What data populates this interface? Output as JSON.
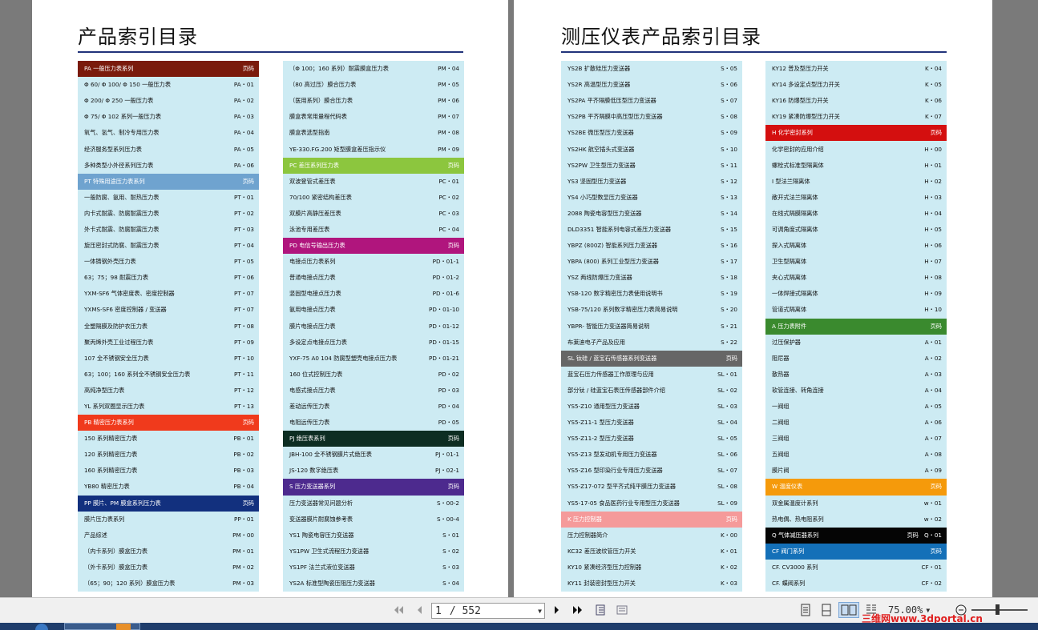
{
  "left_page": {
    "title": "产品索引目录",
    "col1": [
      {
        "label": "PA 一般压力表系列",
        "code": "页码",
        "header": true,
        "color": "#7a1a0c"
      },
      {
        "label": "Φ 60/ Φ 100/ Φ 150 一般压力表",
        "code": "PA・01"
      },
      {
        "label": "Φ 200/ Φ 250 一般压力表",
        "code": "PA・02"
      },
      {
        "label": "Φ 75/ Φ 102 系列一般压力表",
        "code": "PA・03"
      },
      {
        "label": "氧气、氢气、制冷专用压力表",
        "code": "PA・04"
      },
      {
        "label": "经济服务型系列压力表",
        "code": "PA・05"
      },
      {
        "label": "多种类型小外径系列压力表",
        "code": "PA・06"
      },
      {
        "label": "PT 特殊用途压力表系列",
        "code": "页码",
        "header": true,
        "color": "#6fa3cf"
      },
      {
        "label": "一般防腐、氨用、耐热压力表",
        "code": "PT・01"
      },
      {
        "label": "内卡式耐震、防腐耐震压力表",
        "code": "PT・02"
      },
      {
        "label": "外卡式耐震、防腐耐震压力表",
        "code": "PT・03"
      },
      {
        "label": "旋压密封式防腐、耐震压力表",
        "code": "PT・04"
      },
      {
        "label": "一体铸钢外壳压力表",
        "code": "PT・05"
      },
      {
        "label": "63；75；98 耐震压力表",
        "code": "PT・06"
      },
      {
        "label": "YXM-SF6 气体密度表、密度控制器",
        "code": "PT・07"
      },
      {
        "label": "YXMS-SF6 密度控制器 / 变送器",
        "code": "PT・07"
      },
      {
        "label": "全塑隔膜及防护衣压力表",
        "code": "PT・08"
      },
      {
        "label": "聚丙烯外壳工业过程压力表",
        "code": "PT・09"
      },
      {
        "label": "107 全不锈钢安全压力表",
        "code": "PT・10"
      },
      {
        "label": "63；100；160 系列全不锈钢安全压力表",
        "code": "PT・11"
      },
      {
        "label": "高纯净型压力表",
        "code": "PT・12"
      },
      {
        "label": "YL 系列双圈显示压力表",
        "code": "PT・13"
      },
      {
        "label": "PB 精密压力表系列",
        "code": "页码",
        "header": true,
        "color": "#f03a1c"
      },
      {
        "label": "150 系列精密压力表",
        "code": "PB・01"
      },
      {
        "label": "120 系列精密压力表",
        "code": "PB・02"
      },
      {
        "label": "160 系列精密压力表",
        "code": "PB・03"
      },
      {
        "label": "YB80 精密压力表",
        "code": "PB・04"
      },
      {
        "label": "PP 膜片、PM 膜盒系列压力表",
        "code": "页码",
        "header": true,
        "color": "#12307e"
      },
      {
        "label": "膜片压力表系列",
        "code": "PP・01"
      },
      {
        "label": "产品综述",
        "code": "PM・00"
      },
      {
        "label": "（内卡系列）膜盒压力表",
        "code": "PM・01"
      },
      {
        "label": "（外卡系列）膜盒压力表",
        "code": "PM・02"
      },
      {
        "label": "（65；90；120 系列）膜盒压力表",
        "code": "PM・03"
      }
    ],
    "col2": [
      {
        "label": "（Φ 100；160 系列）耐震膜盒压力表",
        "code": "PM・04"
      },
      {
        "label": "（80 高过压）膜合压力表",
        "code": "PM・05"
      },
      {
        "label": "（医用系列）膜合压力表",
        "code": "PM・06"
      },
      {
        "label": "膜盒表常用量程代码表",
        "code": "PM・07"
      },
      {
        "label": "膜盒表选型指南",
        "code": "PM・08"
      },
      {
        "label": "YE-330.FG.200 矩型膜盒差压指示仪",
        "code": "PM・09"
      },
      {
        "label": "PC 差压系列压力表",
        "code": "页码",
        "header": true,
        "color": "#8cc63e"
      },
      {
        "label": "双波登管式差压表",
        "code": "PC・01"
      },
      {
        "label": "70/100 紧密结构差压表",
        "code": "PC・02"
      },
      {
        "label": "双膜片高静压差压表",
        "code": "PC・03"
      },
      {
        "label": "泳池专用差压表",
        "code": "PC・04"
      },
      {
        "label": "PD 电信号输出压力表",
        "code": "页码",
        "header": true,
        "color": "#b0157d"
      },
      {
        "label": "电接点压力表系列",
        "code": "PD・01-1"
      },
      {
        "label": "普通电接点压力表",
        "code": "PD・01-2"
      },
      {
        "label": "竖固型电接点压力表",
        "code": "PD・01-6"
      },
      {
        "label": "氨用电接点压力表",
        "code": "PD・01-10"
      },
      {
        "label": "膜片电接点压力表",
        "code": "PD・01-12"
      },
      {
        "label": "多设定点电接点压力表",
        "code": "PD・01-15"
      },
      {
        "label": "YXF-75 A0 104 防腐型塑壳电接点压力表",
        "code": "PD・01-21"
      },
      {
        "label": "160 位式控制压力表",
        "code": "PD・02"
      },
      {
        "label": "电感式接点压力表",
        "code": "PD・03"
      },
      {
        "label": "差动远传压力表",
        "code": "PD・04"
      },
      {
        "label": "电阻远传压力表",
        "code": "PD・05"
      },
      {
        "label": "PJ 绝压表系列",
        "code": "页码",
        "header": true,
        "color": "#0d2d22"
      },
      {
        "label": "JBH-100 全不锈钢膜片式绝压表",
        "code": "PJ・01-1"
      },
      {
        "label": "JS-120 数字绝压表",
        "code": "PJ・02-1"
      },
      {
        "label": "S 压力变送器系列",
        "code": "页码",
        "header": true,
        "color": "#4d2a8e"
      },
      {
        "label": "压力变送器常见问题分析",
        "code": "S・00-2"
      },
      {
        "label": "变送器膜片耐腐蚀参考表",
        "code": "S・00-4"
      },
      {
        "label": "YS1 陶瓷电容压力变送器",
        "code": "S・01"
      },
      {
        "label": "YS1PW 卫生式流程压力变送器",
        "code": "S・02"
      },
      {
        "label": "YS1PF 法兰式液位变送器",
        "code": "S・03"
      },
      {
        "label": "YS2A 标准型陶瓷压阻压力变送器",
        "code": "S・04"
      }
    ]
  },
  "right_page": {
    "title": "测压仪表产品索引目录",
    "col1": [
      {
        "label": "YS2B 扩散硅压力变送器",
        "code": "S・05"
      },
      {
        "label": "YS2R 高温型压力变送器",
        "code": "S・06"
      },
      {
        "label": "YS2PA 平齐隔膜低压型压力变送器",
        "code": "S・07"
      },
      {
        "label": "YS2PB 平齐隔膜中高压型压力变送器",
        "code": "S・08"
      },
      {
        "label": "YS2BE 微压型压力变送器",
        "code": "S・09"
      },
      {
        "label": "YS2HK 航空插头式变送器",
        "code": "S・10"
      },
      {
        "label": "YS2PW 卫生型压力变送器",
        "code": "S・11"
      },
      {
        "label": "YS3 坚固型压力变送器",
        "code": "S・12"
      },
      {
        "label": "YS4 小巧型数显压力变送器",
        "code": "S・13"
      },
      {
        "label": "2088 陶瓷电容型压力变送器",
        "code": "S・14"
      },
      {
        "label": "DLD3351 智能系列电容式差压力变送器",
        "code": "S・15"
      },
      {
        "label": "YBPZ (800Z) 智能系列压力变送器",
        "code": "S・16"
      },
      {
        "label": "YBPA (800) 系列工业型压力变送器",
        "code": "S・17"
      },
      {
        "label": "YSZ 两线防爆压力变送器",
        "code": "S・18"
      },
      {
        "label": "YSB-120 数字精密压力表使用说明书",
        "code": "S・19"
      },
      {
        "label": "YSB-75/120 系列数字精密压力表简易说明",
        "code": "S・20"
      },
      {
        "label": "YBPR- 智能压力变送器简易说明",
        "code": "S・21"
      },
      {
        "label": "布莱迪电子产品及应用",
        "code": "S・22"
      },
      {
        "label": "SL 钛硅 / 蓝宝石传感器系列变送器",
        "code": "页码",
        "header": true,
        "color": "#666666"
      },
      {
        "label": "蓝宝石压力传感器工作原理与应用",
        "code": "SL・01"
      },
      {
        "label": "部分钛 / 硅蓝宝石表压传感器部件介绍",
        "code": "SL・02"
      },
      {
        "label": "YS5-Z10 通用型压力变送器",
        "code": "SL・03"
      },
      {
        "label": "YS5-Z11-1 型压力变送器",
        "code": "SL・04"
      },
      {
        "label": "YS5-Z11-2 型压力变送器",
        "code": "SL・05"
      },
      {
        "label": "YS5-Z13 型发动机专用压力变送器",
        "code": "SL・06"
      },
      {
        "label": "YS5-Z16 型印染行业专用压力变送器",
        "code": "SL・07"
      },
      {
        "label": "YS5-Z17-072 型平齐式纯平膜压力变送器",
        "code": "SL・08"
      },
      {
        "label": "YS5-17-05 食品医药行业专用型压力变送器",
        "code": "SL・09"
      },
      {
        "label": "K 压力控制器",
        "code": "页码",
        "header": true,
        "color": "#f59a9a"
      },
      {
        "label": "压力控制器简介",
        "code": "K・00"
      },
      {
        "label": "KC32 差压波纹管压力开关",
        "code": "K・01"
      },
      {
        "label": "KY10 紧凑经济型压力控制器",
        "code": "K・02"
      },
      {
        "label": "KY11 封装密封型压力开关",
        "code": "K・03"
      }
    ],
    "col2": [
      {
        "label": "KY12 普及型压力开关",
        "code": "K・04"
      },
      {
        "label": "KY14 多设定点型压力开关",
        "code": "K・05"
      },
      {
        "label": "KY16 防爆型压力开关",
        "code": "K・06"
      },
      {
        "label": "KY19 紧凑防爆型压力开关",
        "code": "K・07"
      },
      {
        "label": "H 化学密封系列",
        "code": "页码",
        "header": true,
        "color": "#d40f0f"
      },
      {
        "label": "化学密封的应用介绍",
        "code": "H・00"
      },
      {
        "label": "螺栓式标准型隔离体",
        "code": "H・01"
      },
      {
        "label": "I 型法兰隔离体",
        "code": "H・02"
      },
      {
        "label": "敞开式法兰隔离体",
        "code": "H・03"
      },
      {
        "label": "在线式隔膜隔离体",
        "code": "H・04"
      },
      {
        "label": "可调角度式隔离体",
        "code": "H・05"
      },
      {
        "label": "探入式隔离体",
        "code": "H・06"
      },
      {
        "label": "卫生型隔离体",
        "code": "H・07"
      },
      {
        "label": "夹心式隔离体",
        "code": "H・08"
      },
      {
        "label": "一体焊接式隔离体",
        "code": "H・09"
      },
      {
        "label": "管道式隔离体",
        "code": "H・10"
      },
      {
        "label": "A 压力表附件",
        "code": "页码",
        "header": true,
        "color": "#3a8a2e"
      },
      {
        "label": "过压保护器",
        "code": "A・01"
      },
      {
        "label": "阻尼器",
        "code": "A・02"
      },
      {
        "label": "散热器",
        "code": "A・03"
      },
      {
        "label": "软管连接、转角连接",
        "code": "A・04"
      },
      {
        "label": "一阀组",
        "code": "A・05"
      },
      {
        "label": "二阀组",
        "code": "A・06"
      },
      {
        "label": "三阀组",
        "code": "A・07"
      },
      {
        "label": "五阀组",
        "code": "A・08"
      },
      {
        "label": "膜片阀",
        "code": "A・09"
      },
      {
        "label": "W 温度仪表",
        "code": "页码",
        "header": true,
        "color": "#f59a0b"
      },
      {
        "label": "双金属温度计系列",
        "code": "w・01"
      },
      {
        "label": "热电偶、热电阻系列",
        "code": "w・02"
      },
      {
        "label": "Q 气体减压器系列",
        "code": "页码　Q・01",
        "header": true,
        "color": "#050505"
      },
      {
        "label": "CF 阀门系列",
        "code": "页码",
        "header": true,
        "color": "#1470b8"
      },
      {
        "label": "CF. CV3000 系列",
        "code": "CF・01"
      },
      {
        "label": "CF. 蝶阀系列",
        "code": "CF・02"
      }
    ]
  },
  "toolbar": {
    "page_current": "1",
    "page_total": "/ 552",
    "zoom": "75.00%"
  },
  "watermark": "三维网www.3dportal.cn"
}
